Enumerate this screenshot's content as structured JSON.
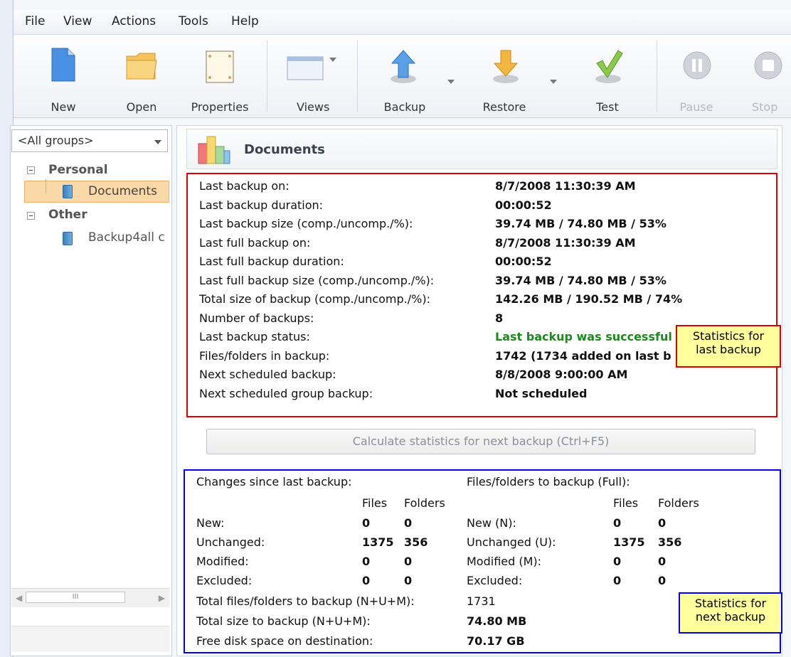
{
  "menu": [
    "File",
    "View",
    "Actions",
    "Tools",
    "Help"
  ],
  "toolbar": {
    "new": "New",
    "open": "Open",
    "properties": "Properties",
    "views": "Views",
    "backup": "Backup",
    "restore": "Restore",
    "test": "Test",
    "pause": "Pause",
    "stop": "Stop"
  },
  "sidebar": {
    "group_select": "<All groups>",
    "tree": {
      "personal": "Personal",
      "documents": "Documents",
      "other": "Other",
      "backup4all": "Backup4all c"
    },
    "scroll_thumb": "III"
  },
  "header": {
    "title": "Documents"
  },
  "stats_last": [
    {
      "label": "Last backup on:",
      "value": "8/7/2008 11:30:39 AM"
    },
    {
      "label": "Last backup duration:",
      "value": "00:00:52"
    },
    {
      "label": "Last backup size (comp./uncomp./%):",
      "value": "39.74 MB / 74.80 MB / 53%"
    },
    {
      "label": "Last full backup on:",
      "value": "8/7/2008 11:30:39 AM"
    },
    {
      "label": "Last full backup duration:",
      "value": "00:00:52"
    },
    {
      "label": "Last full backup size (comp./uncomp./%):",
      "value": "39.74 MB / 74.80 MB / 53%"
    },
    {
      "label": "Total size of backup (comp./uncomp./%):",
      "value": "142.26 MB / 190.52 MB / 74%"
    },
    {
      "label": "Number of backups:",
      "value": "8"
    },
    {
      "label": "Last backup status:",
      "value": "Last backup was successful"
    },
    {
      "label": "Files/folders in backup:",
      "value": "1742  (1734 added on last b"
    },
    {
      "label": "Next scheduled backup:",
      "value": "8/8/2008 9:00:00 AM"
    },
    {
      "label": "Next scheduled group backup:",
      "value": "Not scheduled"
    }
  ],
  "callouts": {
    "last": [
      "Statistics for",
      "last backup"
    ],
    "next": [
      "Statistics for",
      "next backup"
    ]
  },
  "calc_button": "Calculate statistics for next backup (Ctrl+F5)",
  "next": {
    "changes_title": "Changes since last backup:",
    "full_title": "Files/folders to backup (Full):",
    "col_files": "Files",
    "col_folders": "Folders",
    "changes_rows": [
      {
        "label": "New:",
        "files": "0",
        "folders": "0"
      },
      {
        "label": "Unchanged:",
        "files": "1375",
        "folders": "356"
      },
      {
        "label": "Modified:",
        "files": "0",
        "folders": "0"
      },
      {
        "label": "Excluded:",
        "files": "0",
        "folders": "0"
      }
    ],
    "full_rows": [
      {
        "label": "New (N):",
        "files": "0",
        "folders": "0"
      },
      {
        "label": "Unchanged (U):",
        "files": "1375",
        "folders": "356"
      },
      {
        "label": "Modified (M):",
        "files": "0",
        "folders": "0"
      },
      {
        "label": "Excluded:",
        "files": "0",
        "folders": "0"
      }
    ],
    "total_files_label": "Total files/folders to backup (N+U+M):",
    "total_files_value": "1731",
    "total_size_label": "Total size to backup (N+U+M):",
    "total_size_value": "74.80 MB",
    "free_space_label": "Free disk space on destination:",
    "free_space_value": "70.17 GB"
  }
}
